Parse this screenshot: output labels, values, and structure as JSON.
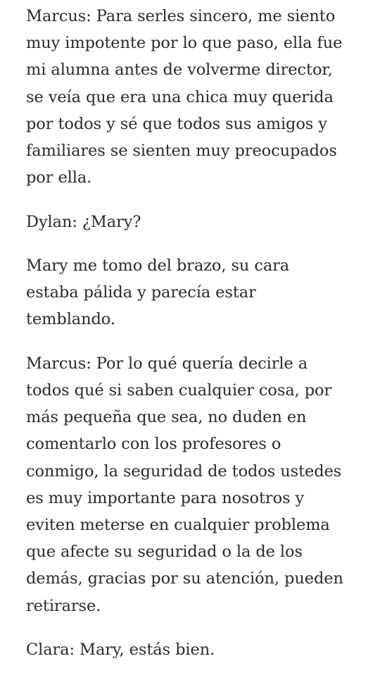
{
  "story": {
    "paragraphs": [
      {
        "lines": [
          "Marcus: Para serles sincero, me siento",
          "muy impotente por lo que paso, ella fue",
          "mi alumna antes de volverme director,",
          "se veía que era una chica muy querida",
          "por todos y sé que todos sus amigos y",
          "familiares se sienten muy preocupados",
          "por ella."
        ]
      },
      {
        "lines": [
          "Dylan: ¿Mary?"
        ]
      },
      {
        "lines": [
          "Mary me tomo del brazo, su cara",
          "estaba pálida y parecía estar",
          "temblando."
        ]
      },
      {
        "lines": [
          "Marcus: Por lo qué quería decirle a",
          "todos qué si saben cualquier cosa, por",
          "más pequeña que sea, no duden en",
          "comentarlo con los profesores o",
          "conmigo, la seguridad de todos ustedes",
          "es muy importante para nosotros y",
          "eviten meterse en cualquier problema",
          "que afecte su seguridad o la de los",
          "demás, gracias por su atención, pueden",
          "retirarse."
        ]
      },
      {
        "lines": [
          "Clara: Mary, estás bien."
        ]
      }
    ]
  }
}
